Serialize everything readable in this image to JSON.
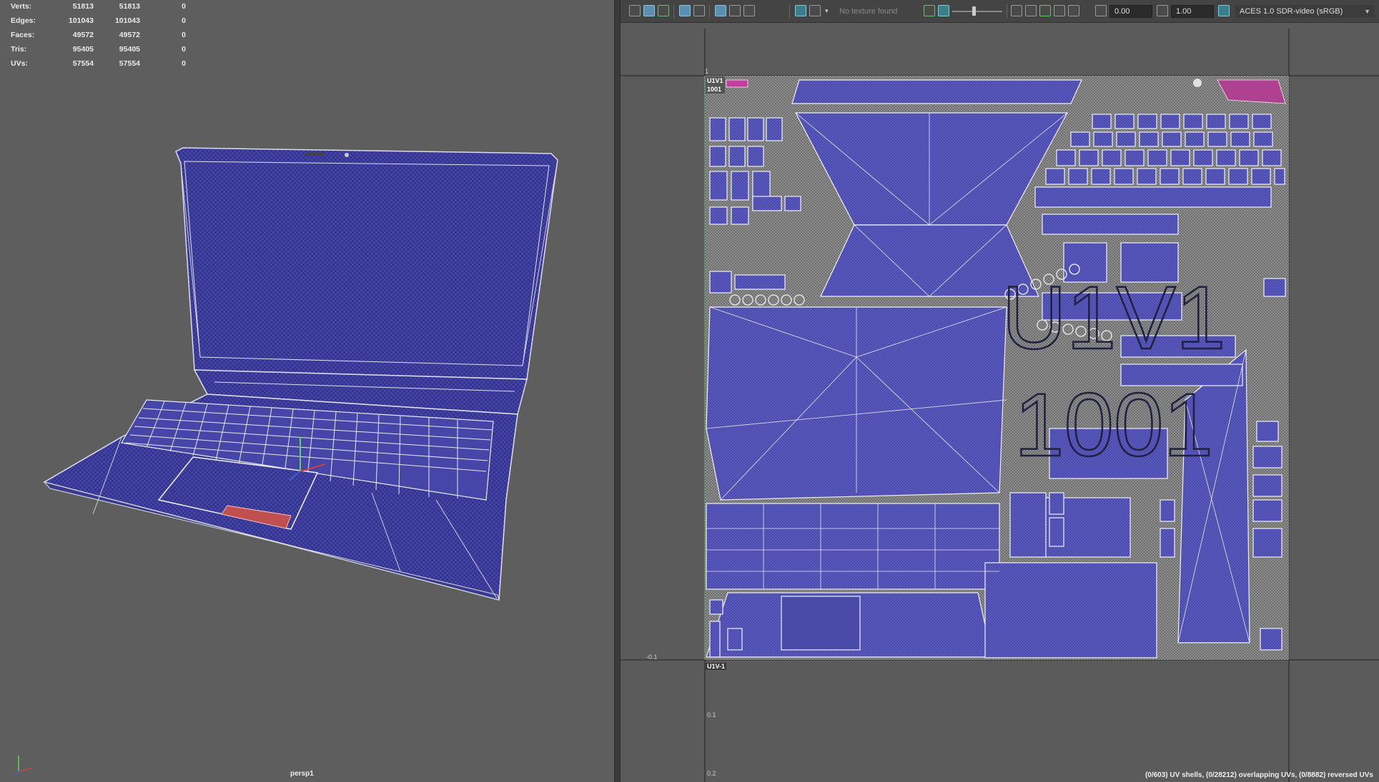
{
  "viewport": {
    "camera": "persp1",
    "stats": [
      {
        "label": "Verts:",
        "v1": "51813",
        "v2": "51813",
        "v3": "0"
      },
      {
        "label": "Edges:",
        "v1": "101043",
        "v2": "101043",
        "v3": "0"
      },
      {
        "label": "Faces:",
        "v1": "49572",
        "v2": "49572",
        "v3": "0"
      },
      {
        "label": "Tris:",
        "v1": "95405",
        "v2": "95405",
        "v3": "0"
      },
      {
        "label": "UVs:",
        "v1": "57554",
        "v2": "57554",
        "v3": "0"
      }
    ]
  },
  "uv_editor": {
    "toolbar": {
      "texture_status": "No texture found",
      "exposure": "0.00",
      "gamma": "1.00",
      "color_space": "ACES 1.0 SDR-video (sRGB)"
    },
    "tile": {
      "label_line1": "U1V1",
      "label_line2": "1001",
      "big_line1": "U1V1",
      "big_line2": "1001",
      "neg_label": "U1V-1"
    },
    "axis_ticks": {
      "top": "1",
      "corner": "-0.1",
      "v1": "0.1",
      "v2": "0.2"
    },
    "status": "(0/603) UV shells, (0/28212) overlapping UVs, (0/8882) reversed UVs"
  },
  "colors": {
    "viewport_bg": "#5e5e5e",
    "mesh_fill": "#3f3fa0",
    "wire": "#d8d8e8",
    "selection_red": "#c05050",
    "uv_bg": "#5b5b5b",
    "accent_blue": "#5a8fb0"
  }
}
